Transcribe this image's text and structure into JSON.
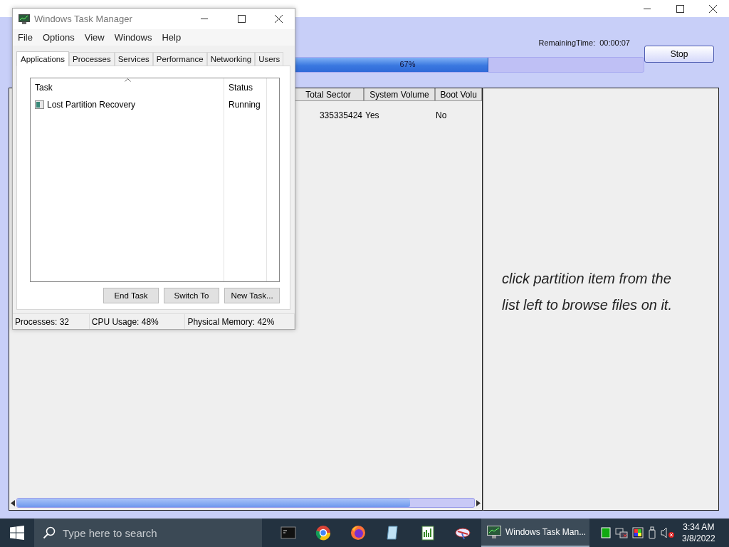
{
  "app_window": {
    "remaining_label": "RemainingTime:",
    "remaining_time": "00:00:07",
    "progress": {
      "level": 0.67,
      "label": "67%"
    },
    "stop_button": "Stop",
    "table": {
      "columns": [
        "Total Sector",
        "System Volume",
        "Boot Volu"
      ],
      "rows": [
        [
          "335335424",
          "Yes",
          "No"
        ]
      ]
    },
    "hint": "click partition item from the list left to browse files on it."
  },
  "task_manager": {
    "title": "Windows Task Manager",
    "menu": [
      "File",
      "Options",
      "View",
      "Windows",
      "Help"
    ],
    "tabs": [
      {
        "label": "Applications",
        "selected": true
      },
      {
        "label": "Processes",
        "selected": false
      },
      {
        "label": "Services",
        "selected": false
      },
      {
        "label": "Performance",
        "selected": false
      },
      {
        "label": "Networking",
        "selected": false
      },
      {
        "label": "Users",
        "selected": false
      }
    ],
    "columns": [
      "Task",
      "Status"
    ],
    "tasks": [
      {
        "name": "Lost Partition Recovery",
        "status": "Running"
      }
    ],
    "buttons": [
      "End Task",
      "Switch To",
      "New Task..."
    ],
    "status_bar": [
      "Processes: 32",
      "CPU Usage: 48%",
      "Physical Memory: 42%"
    ]
  },
  "taskbar": {
    "search": {
      "placeholder": "Type here to search"
    },
    "active_task": "Windows Task Man...",
    "time": "3:34 AM",
    "date": "3/8/2022"
  }
}
